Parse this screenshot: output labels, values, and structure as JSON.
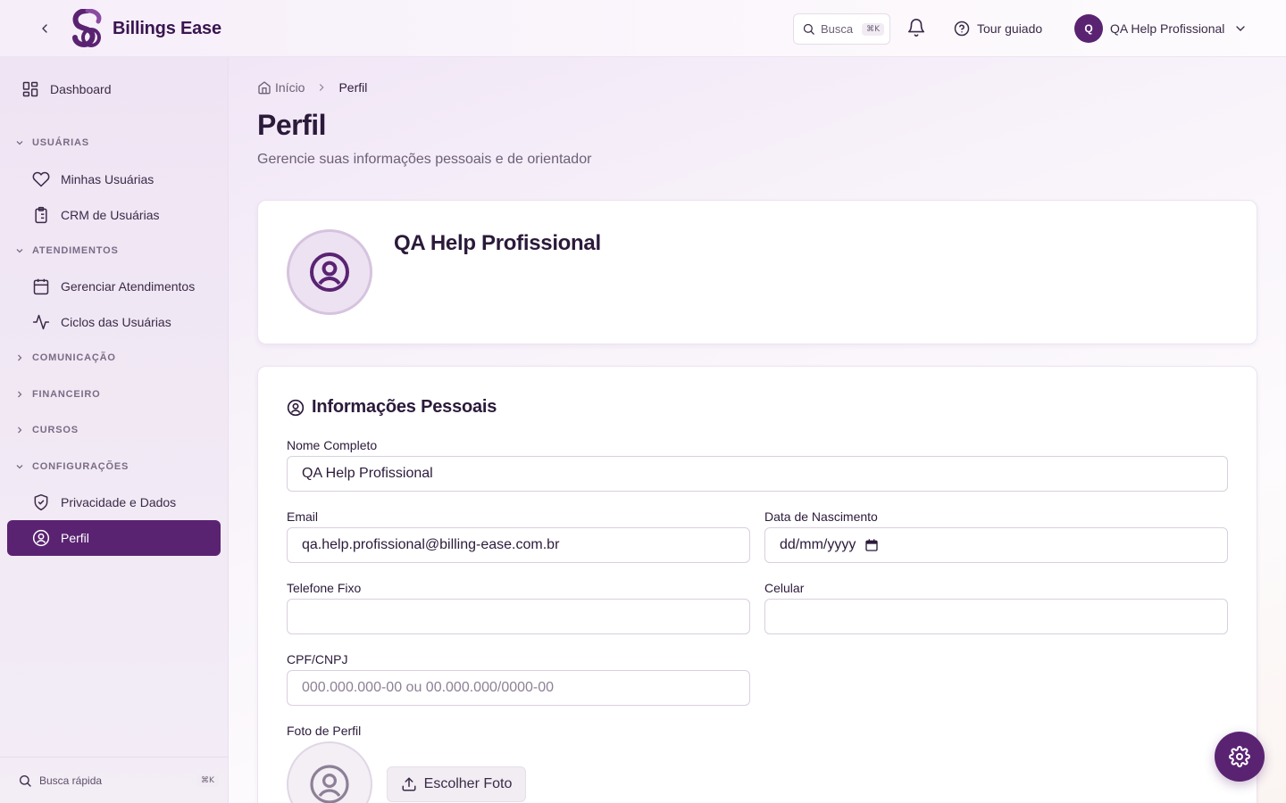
{
  "header": {
    "brand": "Billings Ease",
    "search_label": "Busca",
    "search_shortcut": "⌘K",
    "tour_label": "Tour guiado",
    "user_initial": "Q",
    "user_name": "QA Help Profissional"
  },
  "sidebar": {
    "dashboard": "Dashboard",
    "sections": [
      {
        "title": "USUÁRIAS",
        "expanded": true,
        "items": [
          "Minhas Usuárias",
          "CRM de Usuárias"
        ]
      },
      {
        "title": "ATENDIMENTOS",
        "expanded": true,
        "items": [
          "Gerenciar Atendimentos",
          "Ciclos das Usuárias"
        ]
      },
      {
        "title": "COMUNICAÇÃO",
        "expanded": false
      },
      {
        "title": "FINANCEIRO",
        "expanded": false
      },
      {
        "title": "CURSOS",
        "expanded": false
      },
      {
        "title": "CONFIGURAÇÕES",
        "expanded": true,
        "items": [
          "Privacidade e Dados",
          "Perfil"
        ]
      }
    ],
    "active_item": "Perfil",
    "quick_search_label": "Busca rápida",
    "quick_search_shortcut": "⌘K"
  },
  "breadcrumb": {
    "home": "Início",
    "current": "Perfil"
  },
  "page": {
    "title": "Perfil",
    "subtitle": "Gerencie suas informações pessoais e de orientador"
  },
  "profile_card": {
    "name": "QA Help Profissional"
  },
  "personal_info": {
    "title": "Informações Pessoais",
    "full_name": {
      "label": "Nome Completo",
      "value": "QA Help Profissional"
    },
    "email": {
      "label": "Email",
      "value": "qa.help.profissional@billing-ease.com.br"
    },
    "birth_date": {
      "label": "Data de Nascimento",
      "placeholder": "dd/mm/yyyy"
    },
    "landline": {
      "label": "Telefone Fixo",
      "value": ""
    },
    "mobile": {
      "label": "Celular",
      "value": ""
    },
    "cpf_cnpj": {
      "label": "CPF/CNPJ",
      "placeholder": "000.000.000-00 ou 00.000.000/0000-00"
    },
    "photo": {
      "label": "Foto de Perfil",
      "button": "Escolher Foto"
    }
  },
  "colors": {
    "brand": "#5a2372",
    "text": "#2b1a3a",
    "muted": "#6d6077"
  }
}
